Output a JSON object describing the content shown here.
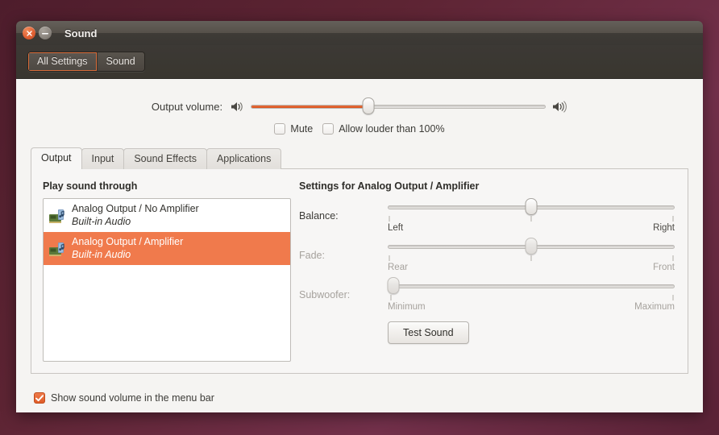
{
  "window": {
    "title": "Sound",
    "close_icon": "close-icon",
    "minimize_icon": "minimize-icon"
  },
  "toolbar": {
    "breadcrumbs": [
      {
        "label": "All Settings",
        "active": true
      },
      {
        "label": "Sound",
        "active": false
      }
    ]
  },
  "volume": {
    "label": "Output volume:",
    "low_icon": "speaker-low-icon",
    "high_icon": "speaker-high-icon",
    "value_percent": 40
  },
  "options": [
    {
      "label": "Mute",
      "checked": false
    },
    {
      "label": "Allow louder than 100%",
      "checked": false
    }
  ],
  "tabs": [
    {
      "label": "Output",
      "active": true
    },
    {
      "label": "Input",
      "active": false
    },
    {
      "label": "Sound Effects",
      "active": false
    },
    {
      "label": "Applications",
      "active": false
    }
  ],
  "output_tab": {
    "list_title": "Play sound through",
    "devices": [
      {
        "name": "Analog Output / No Amplifier",
        "subtitle": "Built-in Audio",
        "selected": false,
        "icon": "sound-card-icon"
      },
      {
        "name": "Analog Output / Amplifier",
        "subtitle": "Built-in Audio",
        "selected": true,
        "icon": "sound-card-icon"
      }
    ],
    "settings_title": "Settings for Analog Output / Amplifier",
    "sliders": [
      {
        "label": "Balance:",
        "left_label": "Left",
        "right_label": "Right",
        "value_percent": 50,
        "enabled": true
      },
      {
        "label": "Fade:",
        "left_label": "Rear",
        "right_label": "Front",
        "value_percent": 50,
        "enabled": false
      },
      {
        "label": "Subwoofer:",
        "left_label": "Minimum",
        "right_label": "Maximum",
        "value_percent": 0,
        "enabled": false
      }
    ],
    "test_sound_label": "Test Sound"
  },
  "bottom": {
    "label": "Show sound volume in the menu bar",
    "checked": true
  },
  "colors": {
    "accent_orange": "#f07a4c",
    "slider_fill": "#d9541f",
    "window_bg": "#f5f4f2",
    "titlebar_dark": "#3e3b36",
    "desktop": "#5a2236"
  }
}
